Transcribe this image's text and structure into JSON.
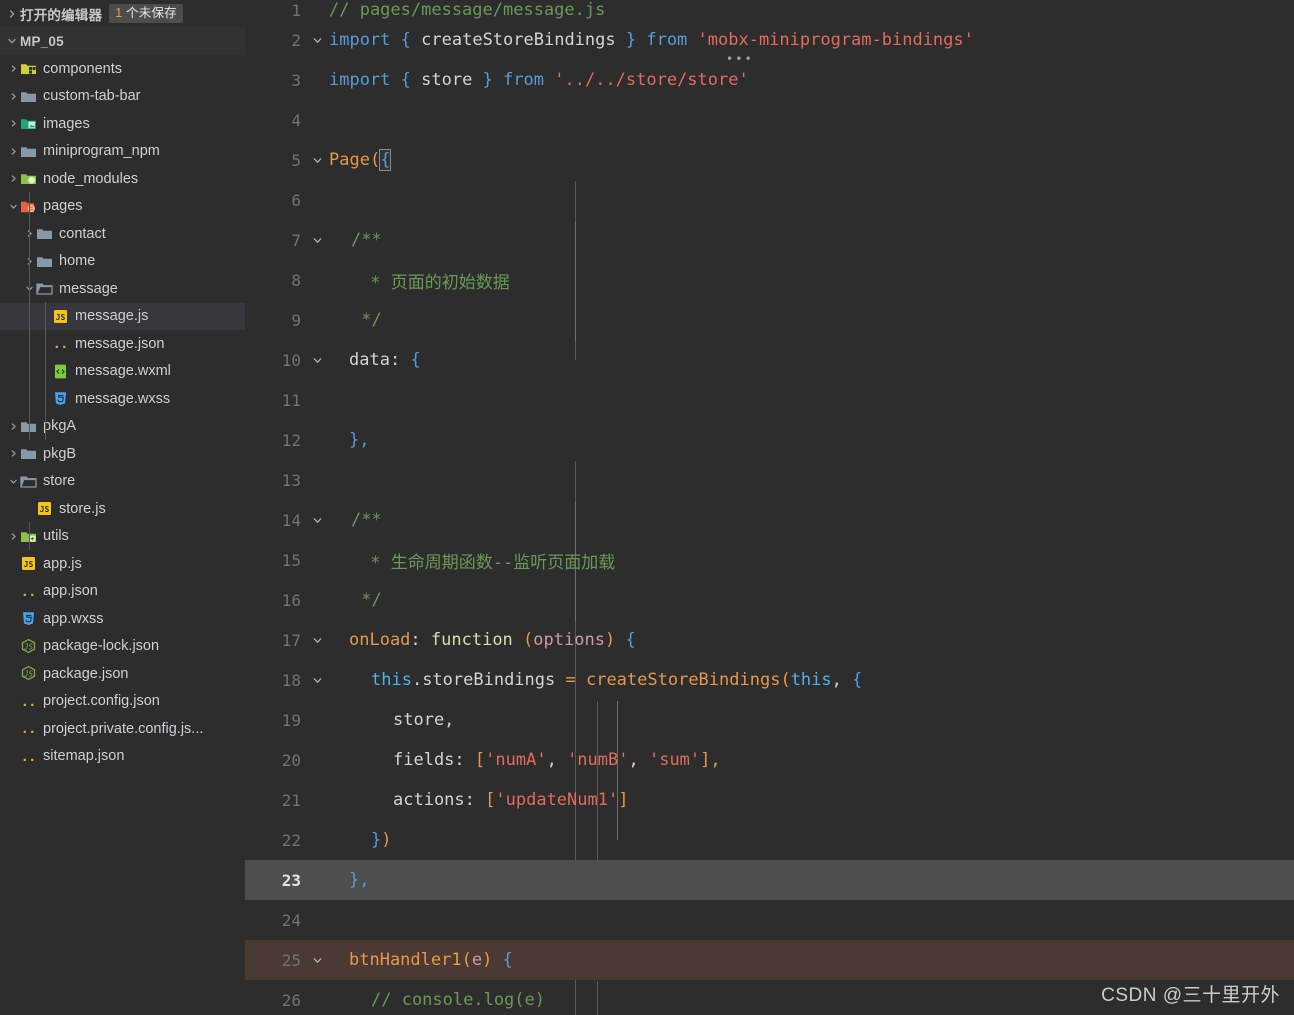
{
  "sidebar": {
    "open_editors": {
      "label": "打开的编辑器",
      "badge_count": "1",
      "badge_text": "个未保存"
    },
    "project": {
      "label": "MP_05"
    },
    "items": [
      {
        "label": "components",
        "icon": "folder-components-icon",
        "depth": 1,
        "kind": "folder",
        "state": "collapsed",
        "selected": false
      },
      {
        "label": "custom-tab-bar",
        "icon": "folder-icon",
        "depth": 1,
        "kind": "folder",
        "state": "collapsed",
        "selected": false
      },
      {
        "label": "images",
        "icon": "folder-images-icon",
        "depth": 1,
        "kind": "folder",
        "state": "collapsed",
        "selected": false
      },
      {
        "label": "miniprogram_npm",
        "icon": "folder-icon",
        "depth": 1,
        "kind": "folder",
        "state": "collapsed",
        "selected": false
      },
      {
        "label": "node_modules",
        "icon": "folder-node-icon",
        "depth": 1,
        "kind": "folder",
        "state": "collapsed",
        "selected": false
      },
      {
        "label": "pages",
        "icon": "folder-pages-open-icon",
        "depth": 1,
        "kind": "folder",
        "state": "expanded",
        "selected": false
      },
      {
        "label": "contact",
        "icon": "folder-icon",
        "depth": 2,
        "kind": "folder",
        "state": "collapsed",
        "selected": false
      },
      {
        "label": "home",
        "icon": "folder-icon",
        "depth": 2,
        "kind": "folder",
        "state": "collapsed",
        "selected": false
      },
      {
        "label": "message",
        "icon": "folder-open-icon",
        "depth": 2,
        "kind": "folder",
        "state": "expanded",
        "selected": false
      },
      {
        "label": "message.js",
        "icon": "js-file-icon",
        "depth": 3,
        "kind": "file",
        "state": "none",
        "selected": true
      },
      {
        "label": "message.json",
        "icon": "json-file-icon",
        "depth": 3,
        "kind": "file",
        "state": "none",
        "selected": false
      },
      {
        "label": "message.wxml",
        "icon": "wxml-file-icon",
        "depth": 3,
        "kind": "file",
        "state": "none",
        "selected": false
      },
      {
        "label": "message.wxss",
        "icon": "css-file-icon",
        "depth": 3,
        "kind": "file",
        "state": "none",
        "selected": false
      },
      {
        "label": "pkgA",
        "icon": "folder-icon",
        "depth": 1,
        "kind": "folder",
        "state": "collapsed",
        "selected": false
      },
      {
        "label": "pkgB",
        "icon": "folder-icon",
        "depth": 1,
        "kind": "folder",
        "state": "collapsed",
        "selected": false
      },
      {
        "label": "store",
        "icon": "folder-open-icon",
        "depth": 1,
        "kind": "folder",
        "state": "expanded",
        "selected": false
      },
      {
        "label": "store.js",
        "icon": "js-file-icon",
        "depth": 2,
        "kind": "file",
        "state": "none",
        "selected": false
      },
      {
        "label": "utils",
        "icon": "folder-utils-icon",
        "depth": 1,
        "kind": "folder",
        "state": "collapsed",
        "selected": false
      },
      {
        "label": "app.js",
        "icon": "js-file-icon",
        "depth": 1,
        "kind": "file",
        "state": "none",
        "selected": false
      },
      {
        "label": "app.json",
        "icon": "json-file-icon",
        "depth": 1,
        "kind": "file",
        "state": "none",
        "selected": false
      },
      {
        "label": "app.wxss",
        "icon": "css-file-icon",
        "depth": 1,
        "kind": "file",
        "state": "none",
        "selected": false
      },
      {
        "label": "package-lock.json",
        "icon": "npm-file-icon",
        "depth": 1,
        "kind": "file",
        "state": "none",
        "selected": false
      },
      {
        "label": "package.json",
        "icon": "npm-file-icon",
        "depth": 1,
        "kind": "file",
        "state": "none",
        "selected": false
      },
      {
        "label": "project.config.json",
        "icon": "json-file-icon",
        "depth": 1,
        "kind": "file",
        "state": "none",
        "selected": false
      },
      {
        "label": "project.private.config.js...",
        "icon": "json-file-icon",
        "depth": 1,
        "kind": "file",
        "state": "none",
        "selected": false
      },
      {
        "label": "sitemap.json",
        "icon": "json-file-icon",
        "depth": 1,
        "kind": "file",
        "state": "none",
        "selected": false
      }
    ]
  },
  "editor": {
    "lines": [
      {
        "no": "1",
        "fold": "",
        "highlight": "none"
      },
      {
        "no": "2",
        "fold": "down",
        "highlight": "none"
      },
      {
        "no": "3",
        "fold": "",
        "highlight": "none"
      },
      {
        "no": "4",
        "fold": "",
        "highlight": "none"
      },
      {
        "no": "5",
        "fold": "down",
        "highlight": "none"
      },
      {
        "no": "6",
        "fold": "",
        "highlight": "none"
      },
      {
        "no": "7",
        "fold": "down",
        "highlight": "none"
      },
      {
        "no": "8",
        "fold": "",
        "highlight": "none"
      },
      {
        "no": "9",
        "fold": "",
        "highlight": "none"
      },
      {
        "no": "10",
        "fold": "down",
        "highlight": "none"
      },
      {
        "no": "11",
        "fold": "",
        "highlight": "none"
      },
      {
        "no": "12",
        "fold": "",
        "highlight": "none"
      },
      {
        "no": "13",
        "fold": "",
        "highlight": "none"
      },
      {
        "no": "14",
        "fold": "down",
        "highlight": "none"
      },
      {
        "no": "15",
        "fold": "",
        "highlight": "none"
      },
      {
        "no": "16",
        "fold": "",
        "highlight": "none"
      },
      {
        "no": "17",
        "fold": "down",
        "highlight": "none"
      },
      {
        "no": "18",
        "fold": "down",
        "highlight": "none"
      },
      {
        "no": "19",
        "fold": "",
        "highlight": "none"
      },
      {
        "no": "20",
        "fold": "",
        "highlight": "none"
      },
      {
        "no": "21",
        "fold": "",
        "highlight": "none"
      },
      {
        "no": "22",
        "fold": "",
        "highlight": "none"
      },
      {
        "no": "23",
        "fold": "",
        "highlight": "active"
      },
      {
        "no": "24",
        "fold": "",
        "highlight": "none"
      },
      {
        "no": "25",
        "fold": "down",
        "highlight": "warn"
      },
      {
        "no": "26",
        "fold": "",
        "highlight": "none"
      }
    ],
    "source": {
      "l1": "// pages/message/message.js",
      "l2": "import { createStoreBindings } from 'mobx-miniprogram-bindings'",
      "l3": "import { store } from '../../store/store'",
      "l5": "Page({",
      "l7": "  /**",
      "l8": "   * 页面的初始数据",
      "l9": "   */",
      "l10": "  data: {",
      "l12": "  },",
      "l14": "  /**",
      "l15": "   * 生命周期函数--监听页面加载",
      "l16": "   */",
      "l17": "  onLoad: function (options) {",
      "l18": "    this.storeBindings = createStoreBindings(this, {",
      "l19": "      store,",
      "l20": "      fields: ['numA', 'numB', 'sum'],",
      "l21": "      actions: ['updateNum1']",
      "l22": "    })",
      "l23": "  },",
      "l25": "  btnHandler1(e) {",
      "l26": "    // console.log(e)"
    },
    "tokens": {
      "comment_l1": "// pages/message/message.js",
      "kw_import": "import",
      "brace_open": "{",
      "brace_close": "}",
      "id_createStoreBindings": " createStoreBindings ",
      "kw_from": " from ",
      "str_mobx": "'mobx-miniprogram-bindings'",
      "id_store": " store ",
      "str_storepath": "'../../store/store'",
      "fn_Page": "Page",
      "paren_open": "(",
      "brace_curly": "{",
      "cmt_open": "/**",
      "cmt_star": " * ",
      "cmt_data_cn": "页面的初始数据",
      "cmt_close": " */",
      "prop_data": "data",
      "colon": ": ",
      "cmt_life_cn": "生命周期函数--监听页面加载",
      "brace_comma": "},",
      "prop_onLoad": "onLoad",
      "kw_function": "function",
      "param_options": "options",
      "kw_this": "this",
      "dot_storeBindings": ".storeBindings",
      "eq": " = ",
      "call_createStoreBindings": "createStoreBindings",
      "arg_this": "this",
      "comma_space": ", ",
      "id_store_plain": "store,",
      "prop_fields": "fields",
      "arr_open": "[",
      "str_numA": "'numA'",
      "str_numB": "'numB'",
      "str_sum": "'sum'",
      "arr_close_comma": "],",
      "prop_actions": "actions",
      "str_updateNum1": "'updateNum1'",
      "arr_close": "]",
      "close_paren": "})",
      "fn_btnHandler1": "btnHandler1",
      "param_e": "e",
      "cmt_console": "// console.log(e)"
    }
  },
  "watermark": {
    "text": "CSDN @三十里开外"
  },
  "colors": {
    "background": "#2d2d2d",
    "sidebar_selected": "#37373d",
    "active_line": "#4e4e4e",
    "warn_line": "#4b3a33",
    "comment_green": "#6a9955",
    "keyword_blue": "#569cd6",
    "string_red": "#e06c5b",
    "function_orange": "#e8974b",
    "variable_lightblue": "#9cdcfe",
    "badge_amber": "#e8a33d"
  }
}
